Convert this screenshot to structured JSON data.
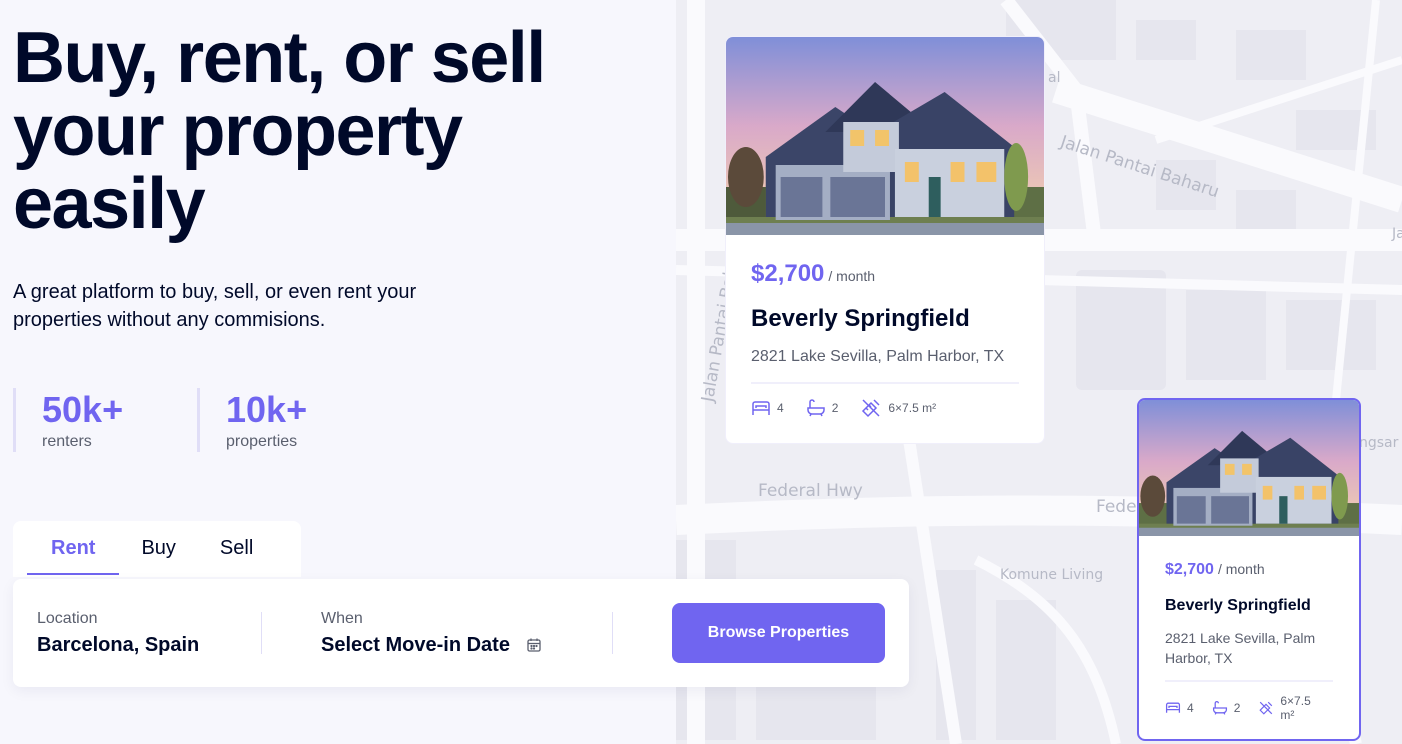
{
  "hero": {
    "title_line1": "Buy, rent, or sell",
    "title_line2": "your property",
    "title_line3": "easily",
    "subtitle": "A great platform to buy, sell, or even rent your properties without any commisions."
  },
  "stats": [
    {
      "value": "50k+",
      "label": "renters"
    },
    {
      "value": "10k+",
      "label": "properties"
    }
  ],
  "search": {
    "tabs": [
      {
        "label": "Rent",
        "active": true
      },
      {
        "label": "Buy",
        "active": false
      },
      {
        "label": "Sell",
        "active": false
      }
    ],
    "location_label": "Location",
    "location_value": "Barcelona, Spain",
    "when_label": "When",
    "when_value": "Select Move-in Date",
    "browse_button": "Browse Properties"
  },
  "map": {
    "labels": [
      "Jalan Pantai Baharu",
      "Jalan Pantai Baharu",
      "Federal Hwy",
      "Fede",
      "Komune Living",
      "ngsar",
      "al",
      "Ja"
    ]
  },
  "cards": [
    {
      "price": "$2,700",
      "per": "/ month",
      "name": "Beverly Springfield",
      "address": "2821 Lake Sevilla, Palm Harbor, TX",
      "beds": "4",
      "baths": "2",
      "size": "6×7.5 m²"
    },
    {
      "price": "$2,700",
      "per": "/ month",
      "name": "Beverly Springfield",
      "address": "2821 Lake Sevilla, Palm Harbor, TX",
      "beds": "4",
      "baths": "2",
      "size": "6×7.5 m²"
    }
  ],
  "colors": {
    "accent": "#7065F0",
    "text_dark": "#000929",
    "text_muted": "#5A5F6E",
    "background": "#F7F7FD"
  }
}
